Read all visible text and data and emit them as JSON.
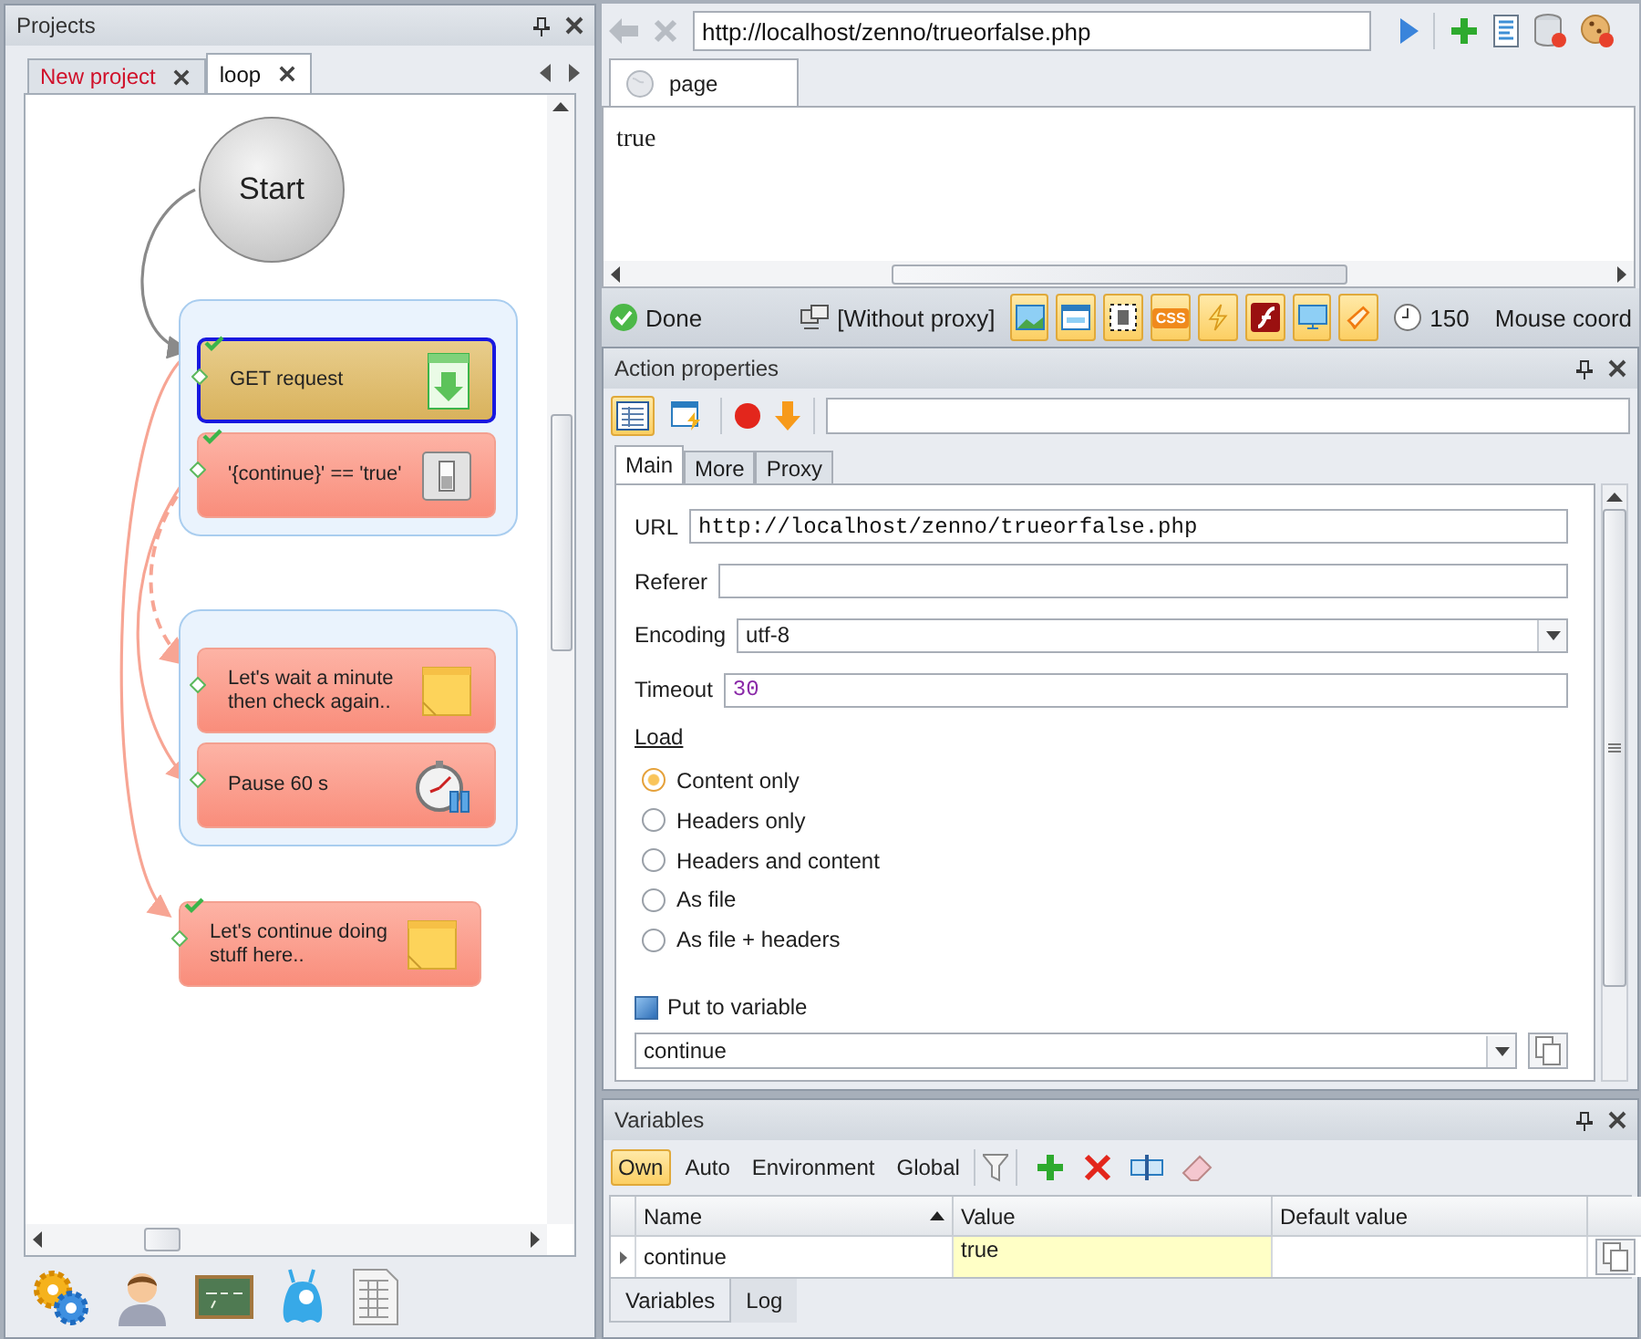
{
  "projects": {
    "title": "Projects",
    "tabs": [
      {
        "label": "New project",
        "selected": false,
        "unsaved": true
      },
      {
        "label": "loop",
        "selected": true,
        "unsaved": false
      }
    ],
    "start": {
      "label": "Start"
    },
    "groups": [
      {
        "nodes": [
          {
            "kind": "request",
            "label": "GET request",
            "selected": true,
            "done": true
          },
          {
            "kind": "condition",
            "label": "'{continue}' == 'true'",
            "selected": false,
            "done": true
          }
        ]
      },
      {
        "nodes": [
          {
            "kind": "note",
            "label": "Let's wait a minute\nthen check again..",
            "selected": false,
            "done": false
          },
          {
            "kind": "pause",
            "label": "Pause 60 s",
            "selected": false,
            "done": false
          }
        ]
      }
    ],
    "nodes": [
      {
        "kind": "note",
        "label": "Let's continue doing\nstuff here..",
        "selected": false,
        "done": true
      }
    ]
  },
  "browser": {
    "url": "http://localhost/zenno/trueorfalse.php",
    "tab": "page",
    "content": "true"
  },
  "status_bar": {
    "status": "Done",
    "proxy": "[Without proxy]",
    "css": "CSS",
    "timeout": "150",
    "mouse": "Mouse coord"
  },
  "action_properties": {
    "title": "Action properties",
    "tabs": [
      {
        "label": "Main",
        "selected": true
      },
      {
        "label": "More",
        "selected": false
      },
      {
        "label": "Proxy",
        "selected": false
      }
    ],
    "fields": [
      {
        "kind": "text",
        "label": "URL",
        "value": "http://localhost/zenno/trueorfalse.php"
      },
      {
        "kind": "text",
        "label": "Referer"
      },
      {
        "kind": "select",
        "label": "Encoding",
        "value": "utf-8"
      },
      {
        "kind": "number",
        "label": "Timeout",
        "value": "30"
      }
    ],
    "load_label": "Load",
    "load_options": [
      {
        "label": "Content only",
        "selected": true
      },
      {
        "label": "Headers only",
        "selected": false
      },
      {
        "label": "Headers and content",
        "selected": false
      },
      {
        "label": "As file",
        "selected": false
      },
      {
        "label": "As file + headers",
        "selected": false
      }
    ],
    "put_to_variable": {
      "label": "Put to variable",
      "checked": true
    },
    "variable": "continue"
  },
  "variables": {
    "title": "Variables",
    "filters": [
      {
        "label": "Own",
        "selected": true
      },
      {
        "label": "Auto",
        "selected": false
      },
      {
        "label": "Environment",
        "selected": false
      },
      {
        "label": "Global",
        "selected": false
      }
    ],
    "columns": [
      "Name",
      "Value",
      "Default value"
    ],
    "rows": [
      {
        "name": "continue",
        "value": "true"
      }
    ],
    "bottom_tabs": [
      {
        "label": "Variables",
        "selected": true
      },
      {
        "label": "Log",
        "selected": false
      }
    ]
  }
}
